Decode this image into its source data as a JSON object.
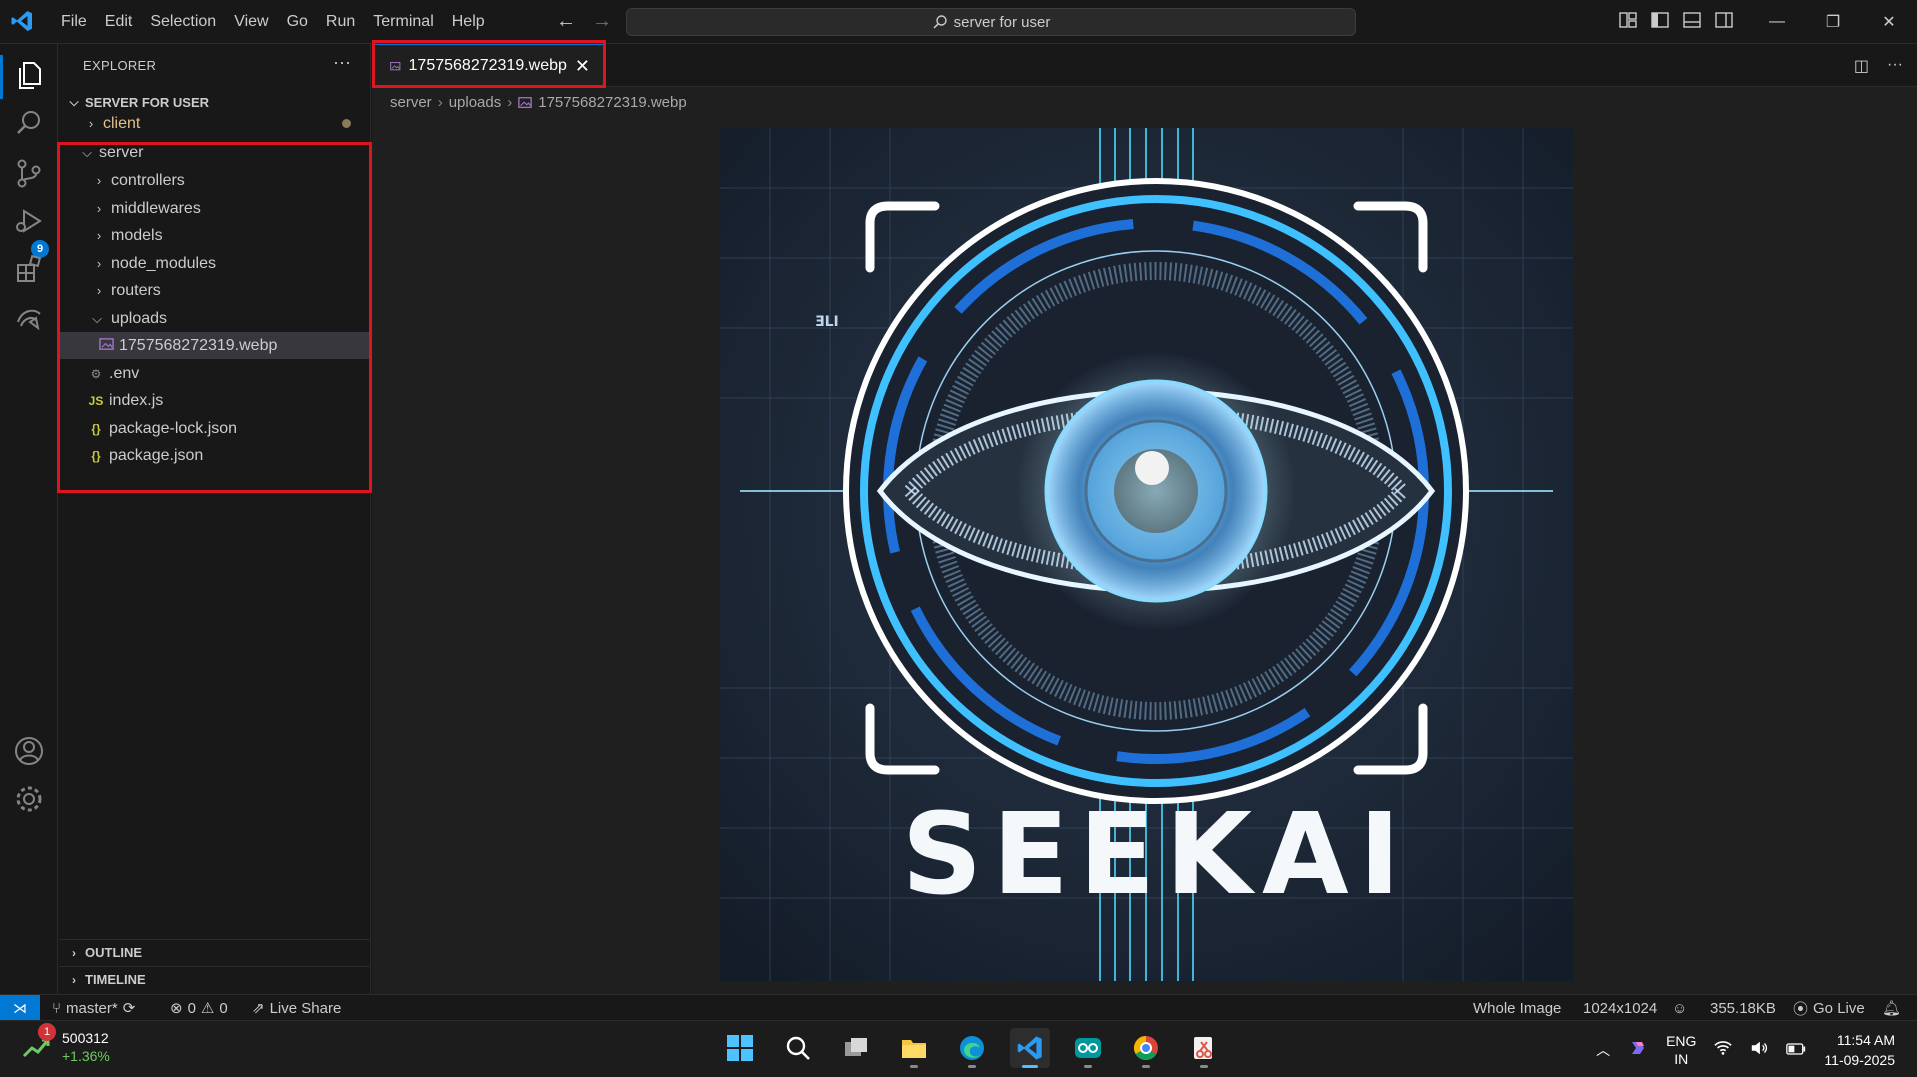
{
  "titlebar": {
    "menu": [
      "File",
      "Edit",
      "Selection",
      "View",
      "Go",
      "Run",
      "Terminal",
      "Help"
    ],
    "search_text": "server for user"
  },
  "activity": {
    "scm_badge": "9"
  },
  "explorer": {
    "header": "EXPLORER",
    "root": "SERVER FOR USER",
    "items": [
      {
        "label": "client",
        "type": "folder",
        "state": "collapsed",
        "depth": 0
      },
      {
        "label": "server",
        "type": "folder",
        "state": "expanded",
        "depth": 0
      },
      {
        "label": "controllers",
        "type": "folder",
        "state": "collapsed",
        "depth": 1
      },
      {
        "label": "middlewares",
        "type": "folder",
        "state": "collapsed",
        "depth": 1
      },
      {
        "label": "models",
        "type": "folder",
        "state": "collapsed",
        "depth": 1
      },
      {
        "label": "node_modules",
        "type": "folder",
        "state": "collapsed",
        "depth": 1
      },
      {
        "label": "routers",
        "type": "folder",
        "state": "collapsed",
        "depth": 1
      },
      {
        "label": "uploads",
        "type": "folder",
        "state": "expanded",
        "depth": 1
      },
      {
        "label": "1757568272319.webp",
        "type": "image",
        "depth": 2
      },
      {
        "label": ".env",
        "type": "env",
        "depth": 1
      },
      {
        "label": "index.js",
        "type": "js",
        "depth": 1
      },
      {
        "label": "package-lock.json",
        "type": "json",
        "depth": 1
      },
      {
        "label": "package.json",
        "type": "json",
        "depth": 1
      }
    ],
    "outline": "OUTLINE",
    "timeline": "TIMELINE"
  },
  "editor": {
    "tab_label": "1757568272319.webp",
    "breadcrumb": [
      "server",
      "uploads",
      "1757568272319.webp"
    ],
    "image_text": "SEEKAI",
    "image_small_text": "ƎLI"
  },
  "statusbar": {
    "branch": "master*",
    "errors": "0",
    "warnings": "0",
    "live_share": "Live Share",
    "zoom": "Whole Image",
    "dimensions": "1024x1024",
    "size": "355.18KB",
    "go_live": "Go Live"
  },
  "taskbar": {
    "stock_value": "500312",
    "stock_change": "+1.36%",
    "stock_badge": "1",
    "lang_top": "ENG",
    "lang_bottom": "IN",
    "time": "11:54 AM",
    "date": "11-09-2025"
  },
  "colors": {
    "accent": "#0078d4",
    "highlight": "#e0141e",
    "modified": "#e2c08d",
    "stock_up": "#6ccb5f"
  }
}
